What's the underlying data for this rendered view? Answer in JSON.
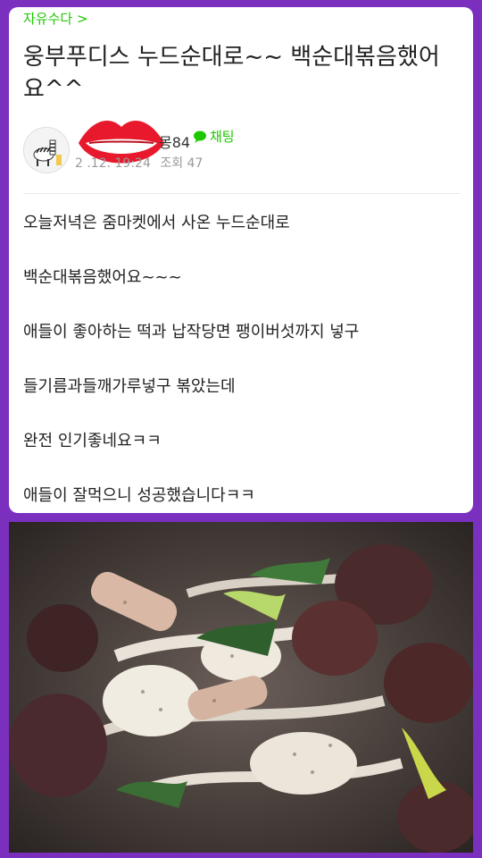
{
  "cafe": {
    "board_link": "자유수다 >"
  },
  "post": {
    "title": "웅부푸디스 누드순대로~~ 백순대볶음했어요^^",
    "author": "몽84",
    "chat_label": "채팅",
    "date": "2 .12. 19:24",
    "views_label": "조회 47"
  },
  "content": {
    "lines": [
      "오늘저녁은 줌마켓에서 사온 누드순대로",
      "백순대볶음했어요~~~",
      "애들이 좋아하는 떡과 납작당면 팽이버섯까지 넣구",
      "들기름과들깨가루넣구 볶았는데",
      "완전 인기좋네요ㅋㅋ",
      "애들이 잘먹으니 성공했습니다ㅋㅋ"
    ]
  },
  "icons": {
    "chat": "chat-bubble-icon",
    "sticker": "lips-sticker",
    "avatar": "zebra-avatar"
  },
  "colors": {
    "frame": "#7b2fbf",
    "accent": "#1ec800"
  }
}
